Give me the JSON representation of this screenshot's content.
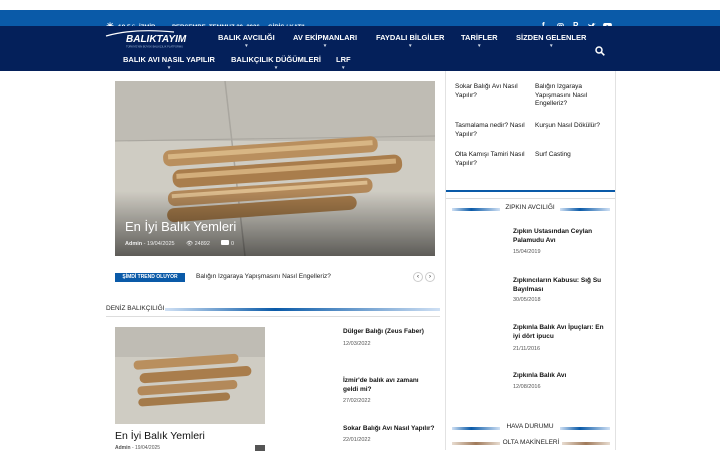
{
  "topbar": {
    "temp": "18.5",
    "temp_unit": "C",
    "city": "İZMİR",
    "date": "PERŞEMBE, TEMMUZ 30, 2026",
    "login": "GİRİŞ / KATIL"
  },
  "social": [
    "facebook-icon",
    "instagram-icon",
    "pinterest-icon",
    "twitter-icon",
    "youtube-icon"
  ],
  "logo": {
    "text": "BALIKTAYIM",
    "tagline": "TÜRKİYE'NİN BÜYÜK BALIKÇILIK PLATFORMU"
  },
  "nav": {
    "row1": [
      "BALIK AVCILIĞI",
      "AV EKİPMANLARI",
      "FAYDALI BİLGİLER",
      "TARİFLER",
      "SİZDEN GELENLER"
    ],
    "row2": [
      "BALIK AVI NASIL YAPILIR",
      "BALIKÇILIK DÜĞÜMLERİ",
      "LRF"
    ]
  },
  "hero": {
    "title": "En İyi Balık Yemleri",
    "author": "Admin",
    "date": "19/04/2025",
    "views": "24892",
    "comments": "0"
  },
  "trend": {
    "label": "ŞİMDİ TREND OLUYOR",
    "text": "Balığın Izgaraya Yapışmasını Nasıl Engelleriz?"
  },
  "sidebar_links": [
    "Sokar Balığı Avı Nasıl Yapılır?",
    "Balığın Izgaraya Yapışmasını Nasıl Engelleriz?",
    "Tasmalama nedir? Nasıl Yapılır?",
    "Kurşun Nasıl Dökülür?",
    "Olta Kamışı Tamiri Nasıl Yapılır?",
    "Surf Casting"
  ],
  "zipkin": {
    "title": "ZIPKIN AVCILIĞI",
    "items": [
      {
        "title": "Zıpkın Ustasından Ceylan Palamudu Avı",
        "date": "15/04/2019"
      },
      {
        "title": "Zıpkıncıların Kabusu: Sığ Su Bayılması",
        "date": "30/05/2018"
      },
      {
        "title": "Zıpkınla Balık Avı İpuçları: En iyi dört ipucu",
        "date": "21/11/2016"
      },
      {
        "title": "Zıpkınla Balık Avı",
        "date": "12/08/2016"
      }
    ]
  },
  "hava": {
    "title": "HAVA DURUMU"
  },
  "olta": {
    "title": "OLTA MAKİNELERİ"
  },
  "deniz": {
    "title": "DENİZ BALIKÇILIĞI",
    "main_title": "En İyi Balık Yemleri",
    "main_author": "Admin",
    "main_date": "19/04/2025",
    "items": [
      {
        "title": "Dülger Balığı (Zeus Faber)",
        "date": "12/03/2022"
      },
      {
        "title": "İzmir'de balık avı zamanı geldi mi?",
        "date": "27/02/2022"
      },
      {
        "title": "Sokar Balığı Avı Nasıl Yapılır?",
        "date": "22/01/2022"
      }
    ]
  },
  "colors": {
    "topbar": "#0a5aa8",
    "nav": "#04205a",
    "accent": "#0a5aa8"
  }
}
